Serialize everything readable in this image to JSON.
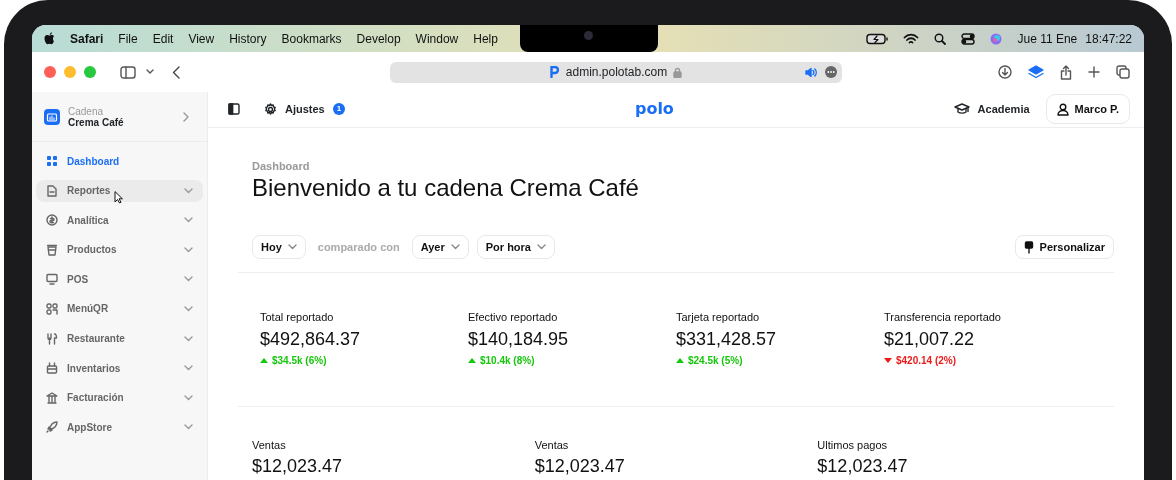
{
  "menubar": {
    "app": "Safari",
    "menus": [
      "File",
      "Edit",
      "View",
      "History",
      "Bookmarks",
      "Develop",
      "Window",
      "Help"
    ],
    "date": "Jue 11 Ene",
    "time": "18:47:22"
  },
  "browser": {
    "url": "admin.polotab.com"
  },
  "sidebar": {
    "org_label": "Cadena",
    "org_name": "Crema Café",
    "items": [
      {
        "label": "Dashboard",
        "kind": "link",
        "selected": true,
        "hovered": false
      },
      {
        "label": "Reportes",
        "kind": "group",
        "selected": false,
        "hovered": true
      },
      {
        "label": "Analítica",
        "kind": "group",
        "selected": false,
        "hovered": false
      },
      {
        "label": "Productos",
        "kind": "group",
        "selected": false,
        "hovered": false
      },
      {
        "label": "POS",
        "kind": "group",
        "selected": false,
        "hovered": false
      },
      {
        "label": "MenúQR",
        "kind": "group",
        "selected": false,
        "hovered": false
      },
      {
        "label": "Restaurante",
        "kind": "group",
        "selected": false,
        "hovered": false
      },
      {
        "label": "Inventarios",
        "kind": "group",
        "selected": false,
        "hovered": false
      },
      {
        "label": "Facturación",
        "kind": "group",
        "selected": false,
        "hovered": false
      },
      {
        "label": "AppStore",
        "kind": "group",
        "selected": false,
        "hovered": false
      }
    ]
  },
  "topbar": {
    "settings": "Ajustes",
    "settings_badge": "1",
    "logo": "polo",
    "academy": "Academia",
    "user": "Marco P."
  },
  "dashboard": {
    "breadcrumb": "Dashboard",
    "title": "Bienvenido a tu cadena Crema Café",
    "filters": [
      {
        "kind": "select",
        "label": "Hoy"
      },
      {
        "kind": "text",
        "label": "comparado con"
      },
      {
        "kind": "select",
        "label": "Ayer"
      },
      {
        "kind": "select",
        "label": "Por hora"
      }
    ],
    "customize": "Personalizar",
    "stats": [
      {
        "label": "Total reportado",
        "value": "$492,864.37",
        "change": "$34.5k (6%)",
        "kind": "increase"
      },
      {
        "label": "Efectivo reportado",
        "value": "$140,184.95",
        "change": "$10.4k (8%)",
        "kind": "increase"
      },
      {
        "label": "Tarjeta reportado",
        "value": "$331,428.57",
        "change": "$24.5k (5%)",
        "kind": "increase"
      },
      {
        "label": "Transferencia reportado",
        "value": "$21,007.22",
        "change": "$420.14 (2%)",
        "kind": "decrease"
      }
    ],
    "summary": [
      {
        "label": "Ventas",
        "value": "$12,023.47"
      },
      {
        "label": "Ventas",
        "value": "$12,023.47"
      },
      {
        "label": "Ultimos pagos",
        "value": "$12,023.47"
      }
    ]
  }
}
